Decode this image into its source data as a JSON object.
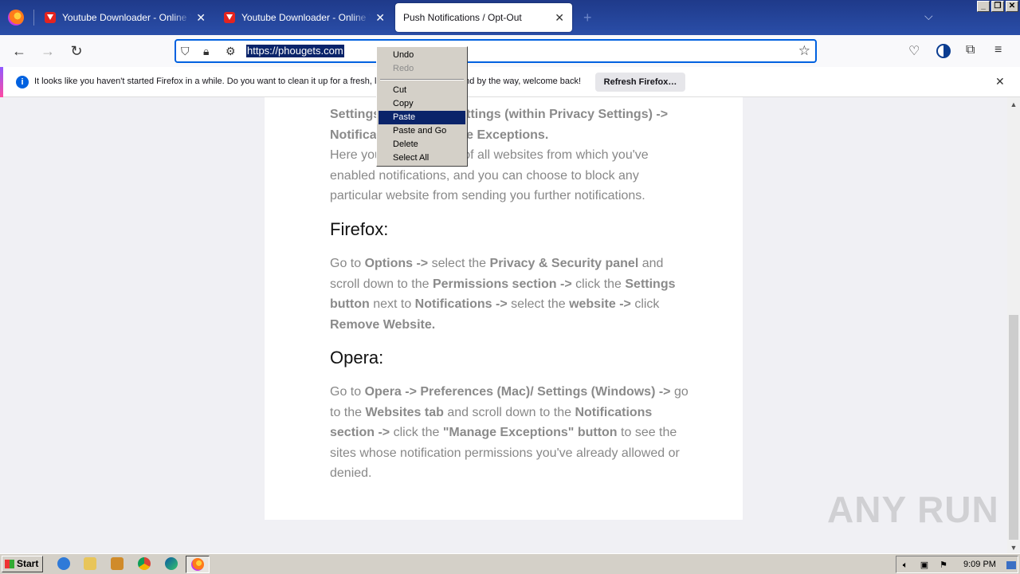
{
  "tabs": [
    {
      "label": "Youtube Downloader - Online Youtube",
      "active": false
    },
    {
      "label": "Youtube Downloader - Online Youtube",
      "active": false
    },
    {
      "label": "Push Notifications / Opt-Out",
      "active": true
    }
  ],
  "toolbar": {
    "url": "https://phougets.com"
  },
  "notification": {
    "text": "It looks like you haven't started Firefox in a while. Do you want to clean it up for a fresh, like-new experience? And by the way, welcome back!",
    "refresh_label": "Refresh Firefox…"
  },
  "context_menu": {
    "items": [
      "Undo",
      "Redo",
      "Cut",
      "Copy",
      "Paste",
      "Paste and Go",
      "Delete",
      "Select All"
    ],
    "selected": "Paste",
    "disabled": [
      "Redo"
    ]
  },
  "article": {
    "chrome_partial_1": "Settings -> Content Settings (within Privacy Settings) ->",
    "chrome_partial_2": "Notifications -> Manage Exceptions.",
    "chrome_para": "Here you can see a list of all websites from which you've enabled notifications, and you can choose to block any particular website from sending you further notifications.",
    "firefox_heading": "Firefox:",
    "opera_heading": "Opera:"
  },
  "watermark": "ANY RUN",
  "taskbar": {
    "start_label": "Start",
    "clock": "9:09 PM"
  }
}
